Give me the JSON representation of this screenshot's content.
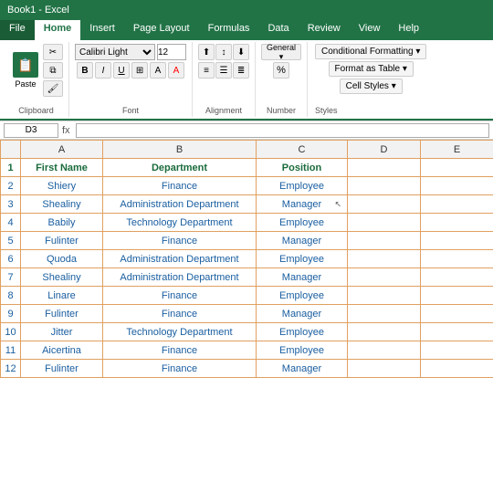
{
  "titlebar": {
    "text": "Book1 - Excel"
  },
  "ribbon": {
    "tabs": [
      "File",
      "Home",
      "Insert",
      "Page Layout",
      "Formulas",
      "Data",
      "Review",
      "View",
      "Help"
    ],
    "active_tab": "Home",
    "clipboard_label": "Clipboard",
    "font_label": "Font",
    "alignment_label": "Alignment",
    "number_label": "Number",
    "styles_label": "Styles",
    "font_name": "Calibri Light",
    "font_size": "12",
    "paste_label": "Paste",
    "bold_label": "B",
    "italic_label": "I",
    "underline_label": "U",
    "conditional_formatting": "Conditional Formatting",
    "format_as_table": "Format as Table",
    "cell_styles": "Cell Styles"
  },
  "formula_bar": {
    "name_box": "D3"
  },
  "sheet": {
    "col_headers": [
      "",
      "A",
      "B",
      "C",
      "D",
      "E"
    ],
    "headers": [
      "",
      "First Name",
      "Department",
      "Position",
      "",
      ""
    ],
    "rows": [
      {
        "num": "2",
        "first_name": "Shiery",
        "department": "Finance",
        "position": "Employee"
      },
      {
        "num": "3",
        "first_name": "Shealiny",
        "department": "Administration Department",
        "position": "Manager"
      },
      {
        "num": "4",
        "first_name": "Babily",
        "department": "Technology Department",
        "position": "Employee"
      },
      {
        "num": "5",
        "first_name": "Fulinter",
        "department": "Finance",
        "position": "Manager"
      },
      {
        "num": "6",
        "first_name": "Quoda",
        "department": "Administration Department",
        "position": "Employee"
      },
      {
        "num": "7",
        "first_name": "Shealiny",
        "department": "Administration Department",
        "position": "Manager"
      },
      {
        "num": "8",
        "first_name": "Linare",
        "department": "Finance",
        "position": "Employee"
      },
      {
        "num": "9",
        "first_name": "Fulinter",
        "department": "Finance",
        "position": "Manager"
      },
      {
        "num": "10",
        "first_name": "Jitter",
        "department": "Technology Department",
        "position": "Employee"
      },
      {
        "num": "11",
        "first_name": "Aicertina",
        "department": "Finance",
        "position": "Employee"
      },
      {
        "num": "12",
        "first_name": "Fulinter",
        "department": "Finance",
        "position": "Manager"
      }
    ]
  }
}
